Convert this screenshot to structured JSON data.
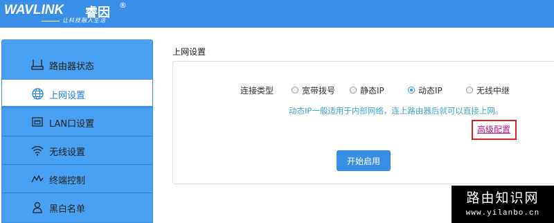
{
  "header": {
    "logo_main": "WAVLINK",
    "logo_cn": "睿因",
    "logo_reg": "®",
    "slogan": "让科技融入生活"
  },
  "sidebar": {
    "items": [
      {
        "label": "路由器状态",
        "icon": "router-icon",
        "active": false
      },
      {
        "label": "上网设置",
        "icon": "globe-icon",
        "active": true
      },
      {
        "label": "LAN口设置",
        "icon": "lan-port-icon",
        "active": false
      },
      {
        "label": "无线设置",
        "icon": "wifi-icon",
        "active": false
      },
      {
        "label": "终端控制",
        "icon": "signal-chart-icon",
        "active": false
      },
      {
        "label": "黑白名单",
        "icon": "user-icon",
        "active": false
      }
    ]
  },
  "main": {
    "title": "上网设置",
    "connection_label": "连接类型",
    "options": [
      {
        "label": "宽带拨号",
        "checked": false
      },
      {
        "label": "静态IP",
        "checked": false
      },
      {
        "label": "动态IP",
        "checked": true
      },
      {
        "label": "无线中继",
        "checked": false
      }
    ],
    "hint": "动态IP一般适用于内部网络，连上路由器后就可以直接上网。",
    "advanced_link": "高级配置",
    "start_button": "开始启用"
  },
  "watermark": {
    "title": "路由知识网",
    "url": "www.yilanbo.cn"
  },
  "colors": {
    "header": "#3a8ee6",
    "sidebar": "#4aa0f0",
    "hint": "#3ba6c7",
    "advanced_link": "#c0188a",
    "highlight_box": "#e02020"
  }
}
